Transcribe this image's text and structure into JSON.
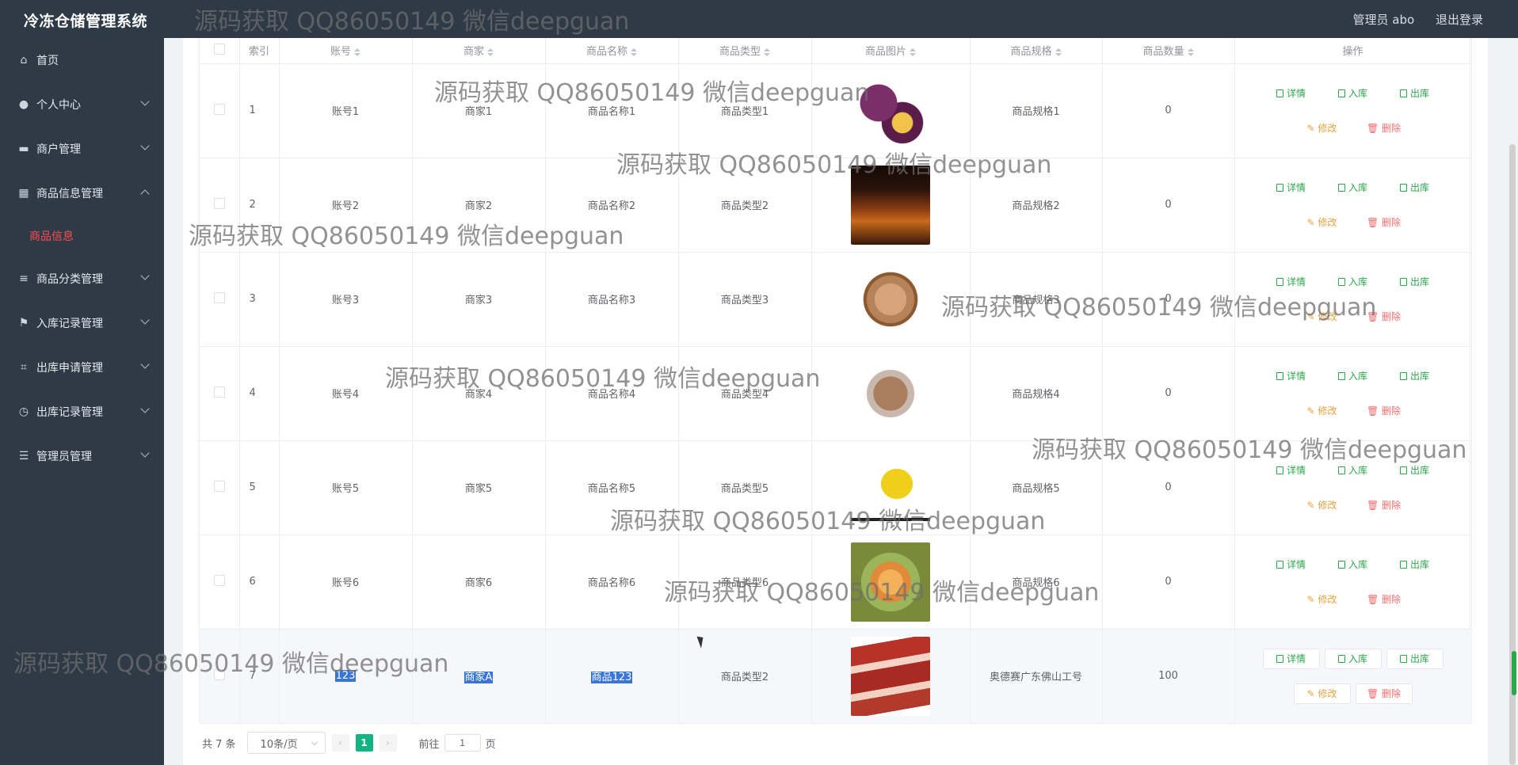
{
  "app": {
    "title": "冷冻仓储管理系统"
  },
  "header": {
    "admin": "管理员 abo",
    "logout": "退出登录"
  },
  "sidebar": {
    "items": [
      {
        "label": "首页",
        "icon": "home-icon"
      },
      {
        "label": "个人中心",
        "icon": "user-icon"
      },
      {
        "label": "商户管理",
        "icon": "monitor-icon"
      },
      {
        "label": "商品信息管理",
        "icon": "grid-icon"
      },
      {
        "label": "商品分类管理",
        "icon": "sliders-icon"
      },
      {
        "label": "入库记录管理",
        "icon": "flag-icon"
      },
      {
        "label": "出库申请管理",
        "icon": "crop-icon"
      },
      {
        "label": "出库记录管理",
        "icon": "clock-icon"
      },
      {
        "label": "管理员管理",
        "icon": "list-icon"
      }
    ],
    "sub_item": "商品信息"
  },
  "table": {
    "headers": [
      "索引",
      "账号",
      "商家",
      "商品名称",
      "商品类型",
      "商品图片",
      "商品规格",
      "商品数量",
      "操作"
    ],
    "rows": [
      {
        "index": "1",
        "account": "账号1",
        "merchant": "商家1",
        "name": "商品名称1",
        "type": "商品类型1",
        "spec": "商品规格1",
        "qty": "0",
        "image": "plum-image"
      },
      {
        "index": "2",
        "account": "账号2",
        "merchant": "商家2",
        "name": "商品名称2",
        "type": "商品类型2",
        "spec": "商品规格2",
        "qty": "0",
        "image": "cognac-image"
      },
      {
        "index": "3",
        "account": "账号3",
        "merchant": "商家3",
        "name": "商品名称3",
        "type": "商品类型3",
        "spec": "商品规格3",
        "qty": "0",
        "image": "eggs-basket-image"
      },
      {
        "index": "4",
        "account": "账号4",
        "merchant": "商家4",
        "name": "商品名称4",
        "type": "商品类型4",
        "spec": "商品规格4",
        "qty": "0",
        "image": "egg-tray-image"
      },
      {
        "index": "5",
        "account": "账号5",
        "merchant": "商家5",
        "name": "商品名称5",
        "type": "商品类型5",
        "spec": "商品规格5",
        "qty": "0",
        "image": "pear-image"
      },
      {
        "index": "6",
        "account": "账号6",
        "merchant": "商家6",
        "name": "商品名称6",
        "type": "商品类型6",
        "spec": "商品规格6",
        "qty": "0",
        "image": "carved-fruit-image"
      },
      {
        "index": "7",
        "account": "123",
        "merchant": "商家A",
        "name": "商品123",
        "type": "商品类型2",
        "spec": "奥德赛广东佛山工号",
        "qty": "100",
        "image": "sausage-image"
      }
    ],
    "actions": {
      "detail": "详情",
      "in": "入库",
      "out": "出库",
      "edit": "修改",
      "delete": "删除"
    }
  },
  "pagination": {
    "total": "共 7 条",
    "page_size": "10条/页",
    "current_page": "1",
    "goto_label": "前往",
    "goto_value": "1",
    "page_suffix": "页"
  },
  "watermark": "源码获取 QQ86050149 微信deepguan",
  "colors": {
    "sidebar_bg": "#2f3a47",
    "active_submenu": "#ff4d4f",
    "pager_active": "#14b383",
    "action_green": "#2aa84a",
    "action_orange": "#e6a23c",
    "action_red": "#f56c6c"
  }
}
